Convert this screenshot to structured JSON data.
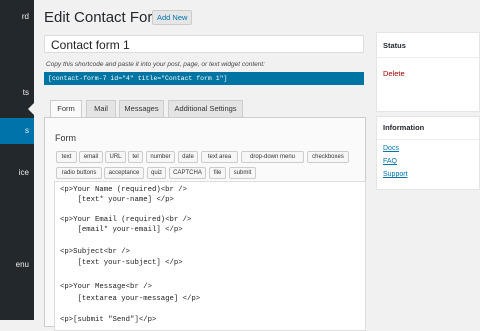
{
  "sidebar": {
    "items": [
      {
        "label": "rd"
      },
      {
        "label": "ts"
      },
      {
        "label": "s"
      },
      {
        "label": "ice"
      },
      {
        "label": "enu"
      }
    ]
  },
  "header": {
    "title": "Edit Contact Form",
    "add_new": "Add New"
  },
  "form": {
    "title_value": "Contact form 1",
    "shortcode_hint": "Copy this shortcode and paste it into your post, page, or text widget content:",
    "shortcode": "[contact-form-7 id=\"4\" title=\"Contact form 1\"]"
  },
  "tabs": [
    {
      "label": "Form"
    },
    {
      "label": "Mail"
    },
    {
      "label": "Messages"
    },
    {
      "label": "Additional Settings"
    }
  ],
  "panel": {
    "title": "Form",
    "tag_buttons_row1": [
      "text",
      "email",
      "URL",
      "tel",
      "number",
      "date",
      "text area",
      "drop-down menu",
      "checkboxes"
    ],
    "tag_buttons_row2": [
      "radio buttons",
      "acceptance",
      "quiz",
      "CAPTCHA",
      "file",
      "submit"
    ],
    "code_lines": [
      "<p>Your Name (required)<br />",
      "    [text* your-name] </p>",
      "",
      "<p>Your Email (required)<br />",
      "    [email* your-email] </p>",
      "",
      "<p>Subject<br />",
      "    [text your-subject] </p>",
      "",
      "<p>Your Message<br />",
      "    [textarea your-message] </p>",
      "",
      "<p>[submit \"Send\"]</p>"
    ]
  },
  "status_box": {
    "title": "Status",
    "delete": "Delete"
  },
  "info_box": {
    "title": "Information",
    "links": [
      "Docs",
      "FAQ",
      "Support"
    ]
  },
  "colors": {
    "sidebar": "#23282d",
    "accent": "#0073aa",
    "shortcode_bg": "#0074a2",
    "delete": "#aa0000"
  }
}
